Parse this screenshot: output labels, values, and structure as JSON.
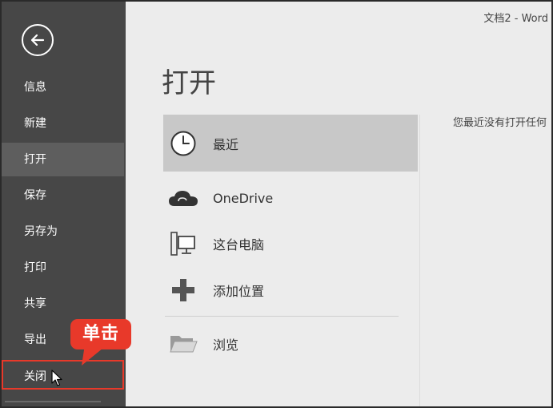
{
  "window": {
    "title": "文档2 - Word"
  },
  "sidebar": {
    "items": [
      {
        "label": "信息"
      },
      {
        "label": "新建"
      },
      {
        "label": "打开"
      },
      {
        "label": "保存"
      },
      {
        "label": "另存为"
      },
      {
        "label": "打印"
      },
      {
        "label": "共享"
      },
      {
        "label": "导出"
      },
      {
        "label": "关闭"
      }
    ],
    "selected_item": "打开",
    "highlighted_item": "关闭"
  },
  "annotation": {
    "callout_text": "单击",
    "color": "#e8392a"
  },
  "main": {
    "title": "打开",
    "places": [
      {
        "label": "最近",
        "icon": "clock-icon"
      },
      {
        "label": "OneDrive",
        "icon": "cloud-icon"
      },
      {
        "label": "这台电脑",
        "icon": "computer-icon"
      },
      {
        "label": "添加位置",
        "icon": "plus-icon"
      },
      {
        "label": "浏览",
        "icon": "folder-icon"
      }
    ],
    "empty_message": "您最近没有打开任何"
  },
  "colors": {
    "sidebar_bg": "#474747",
    "sidebar_selected": "#5e5e5e",
    "place_selected": "#c8c8c8",
    "accent": "#e8392a"
  }
}
